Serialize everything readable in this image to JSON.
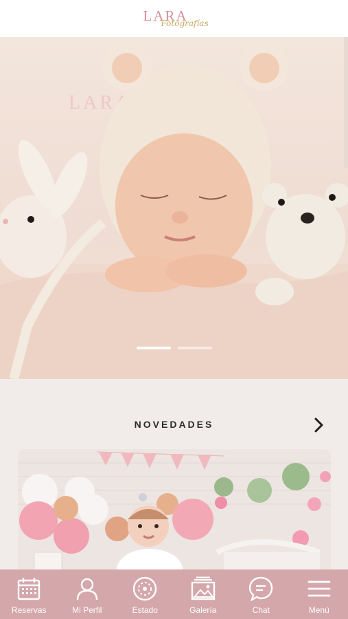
{
  "header": {
    "logo_main": "LARA",
    "logo_sub": "Fotografías"
  },
  "hero": {
    "watermark": "LARA",
    "slides_total": 2,
    "active_slide": 1
  },
  "news": {
    "title": "NOVEDADES"
  },
  "bottom_nav": {
    "items": [
      {
        "label": "Reservas",
        "icon": "calendar-icon"
      },
      {
        "label": "Mi Perfil",
        "icon": "user-icon"
      },
      {
        "label": "Estado",
        "icon": "status-icon"
      },
      {
        "label": "Galería",
        "icon": "gallery-icon"
      },
      {
        "label": "Chat",
        "icon": "chat-icon"
      },
      {
        "label": "Menú",
        "icon": "menu-icon"
      }
    ]
  },
  "colors": {
    "nav_background": "#d4a7ab",
    "page_background": "#f1ecea",
    "brand_pink": "#d98e97"
  }
}
